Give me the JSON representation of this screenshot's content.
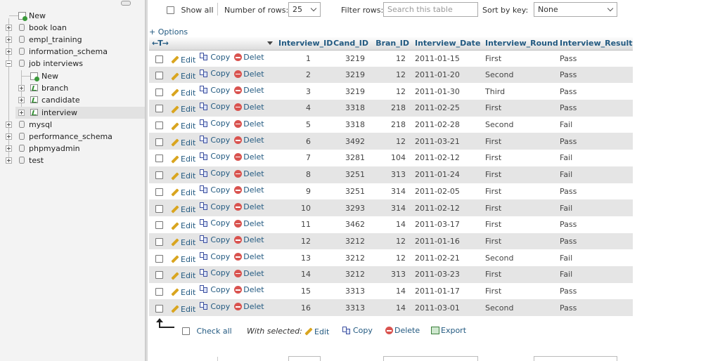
{
  "sidebar": {
    "new_label": "New",
    "databases": [
      {
        "name": "book loan"
      },
      {
        "name": "empl_training"
      },
      {
        "name": "information_schema"
      },
      {
        "name": "job interviews"
      }
    ],
    "sub_new_label": "New",
    "tables": [
      {
        "name": "branch"
      },
      {
        "name": "candidate"
      },
      {
        "name": "interview"
      }
    ],
    "more_databases": [
      {
        "name": "mysql"
      },
      {
        "name": "performance_schema"
      },
      {
        "name": "phpmyadmin"
      },
      {
        "name": "test"
      }
    ]
  },
  "toolbar": {
    "show_all": "Show all",
    "rows_label": "Number of rows:",
    "rows_value": "25",
    "filter_label": "Filter rows:",
    "filter_placeholder": "Search this table",
    "sort_label": "Sort by key:",
    "sort_value": "None",
    "options": "+ Options",
    "resize_arrows": "←T→"
  },
  "table": {
    "columns": [
      "Interview_ID",
      "Cand_ID",
      "Bran_ID",
      "Interview_Date",
      "Interview_Round",
      "Interview_Result"
    ],
    "actions": {
      "edit": "Edit",
      "copy": "Copy",
      "delete": "Delete"
    },
    "rows": [
      {
        "id": "1",
        "cand": "3219",
        "bran": "12",
        "date": "2011-01-15",
        "round": "First",
        "result": "Pass"
      },
      {
        "id": "2",
        "cand": "3219",
        "bran": "12",
        "date": "2011-01-20",
        "round": "Second",
        "result": "Pass"
      },
      {
        "id": "3",
        "cand": "3219",
        "bran": "12",
        "date": "2011-01-30",
        "round": "Third",
        "result": "Pass"
      },
      {
        "id": "4",
        "cand": "3318",
        "bran": "218",
        "date": "2011-02-25",
        "round": "First",
        "result": "Pass"
      },
      {
        "id": "5",
        "cand": "3318",
        "bran": "218",
        "date": "2011-02-28",
        "round": "Second",
        "result": "Fail"
      },
      {
        "id": "6",
        "cand": "3492",
        "bran": "12",
        "date": "2011-03-21",
        "round": "First",
        "result": "Pass"
      },
      {
        "id": "7",
        "cand": "3281",
        "bran": "104",
        "date": "2011-02-12",
        "round": "First",
        "result": "Fail"
      },
      {
        "id": "8",
        "cand": "3251",
        "bran": "313",
        "date": "2011-01-24",
        "round": "First",
        "result": "Fail"
      },
      {
        "id": "9",
        "cand": "3251",
        "bran": "314",
        "date": "2011-02-05",
        "round": "First",
        "result": "Pass"
      },
      {
        "id": "10",
        "cand": "3293",
        "bran": "314",
        "date": "2011-02-12",
        "round": "First",
        "result": "Fail"
      },
      {
        "id": "11",
        "cand": "3462",
        "bran": "14",
        "date": "2011-03-17",
        "round": "First",
        "result": "Pass"
      },
      {
        "id": "12",
        "cand": "3212",
        "bran": "12",
        "date": "2011-01-16",
        "round": "First",
        "result": "Pass"
      },
      {
        "id": "13",
        "cand": "3212",
        "bran": "12",
        "date": "2011-02-21",
        "round": "Second",
        "result": "Fail"
      },
      {
        "id": "14",
        "cand": "3212",
        "bran": "313",
        "date": "2011-03-23",
        "round": "First",
        "result": "Fail"
      },
      {
        "id": "15",
        "cand": "3313",
        "bran": "14",
        "date": "2011-01-17",
        "round": "First",
        "result": "Pass"
      },
      {
        "id": "16",
        "cand": "3313",
        "bran": "14",
        "date": "2011-03-01",
        "round": "Second",
        "result": "Pass"
      }
    ]
  },
  "footer": {
    "check_all": "Check all",
    "with_selected": "With selected:",
    "edit": "Edit",
    "copy": "Copy",
    "delete": "Delete",
    "export": "Export"
  },
  "colors": {
    "link": "#235a81",
    "row_alt": "#e5e5e5",
    "delete": "#d9534f"
  }
}
